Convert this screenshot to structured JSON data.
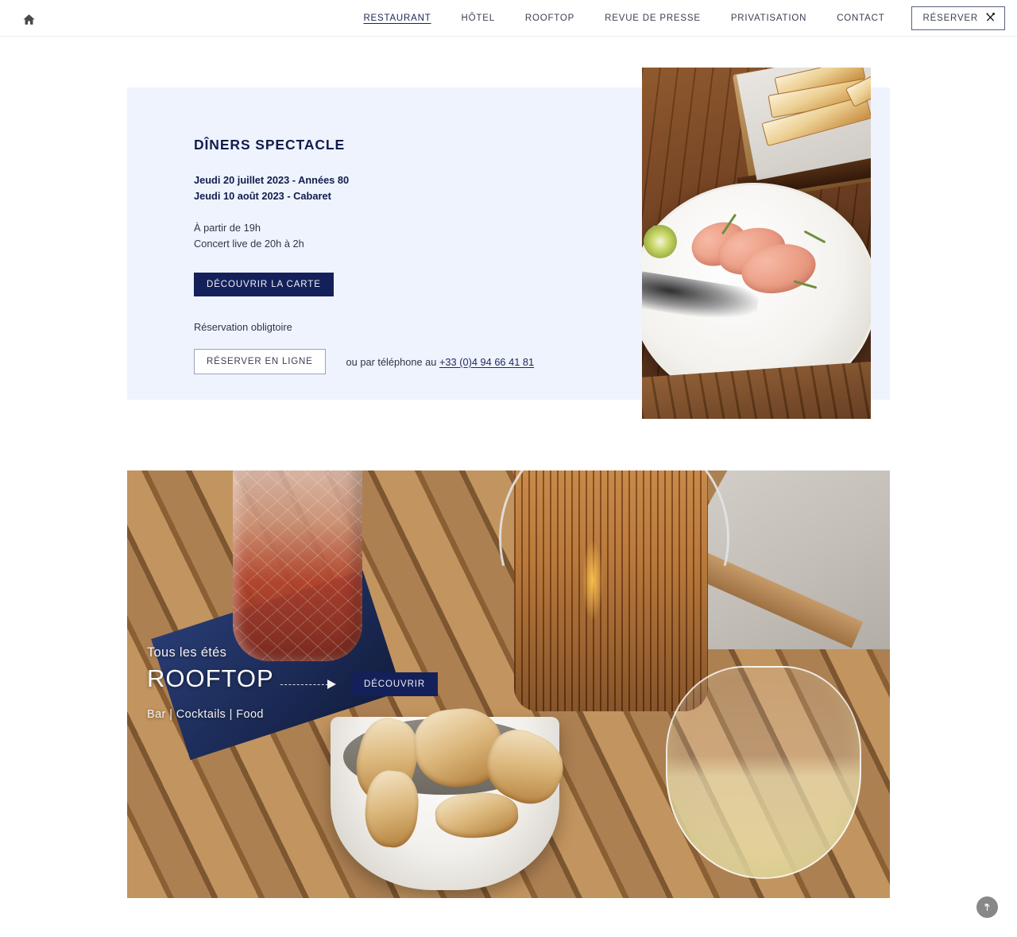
{
  "header": {
    "home_icon": "home-icon",
    "nav": [
      {
        "label": "RESTAURANT",
        "active": true
      },
      {
        "label": "HÔTEL",
        "active": false
      },
      {
        "label": "ROOFTOP",
        "active": false
      },
      {
        "label": "REVUE DE PRESSE",
        "active": false
      },
      {
        "label": "PRIVATISATION",
        "active": false
      },
      {
        "label": "CONTACT",
        "active": false
      }
    ],
    "reserve_button": {
      "label": "RÉSERVER",
      "icon": "cutlery-icon"
    }
  },
  "diners_section": {
    "title": "DÎNERS SPECTACLE",
    "dates": [
      "Jeudi 20 juillet 2023 - Années 80",
      "Jeudi 10 août 2023 - Cabaret"
    ],
    "hours": [
      "À partir de 19h",
      "Concert live de 20h à 2h"
    ],
    "menu_button": "DÉCOUVRIR LA CARTE",
    "reservation_note": "Réservation obligtoire",
    "online_button": "RÉSERVER EN LIGNE",
    "phone_prefix": "ou par téléphone au ",
    "phone_number": "+33 (0)4 94 66 41 81",
    "image_alt": "foie-gras-plate-photo",
    "panel_color": "#eef3fd",
    "accent_color": "#14205a"
  },
  "rooftop_section": {
    "kicker": "Tous les étés",
    "title": "ROOFTOP",
    "subtitle": "Bar | Cocktails | Food",
    "cta_label": "DÉCOUVRIR",
    "image_alt": "rooftop-terrace-cocktail-photo"
  },
  "scroll_top": {
    "icon": "arrow-up-icon"
  }
}
